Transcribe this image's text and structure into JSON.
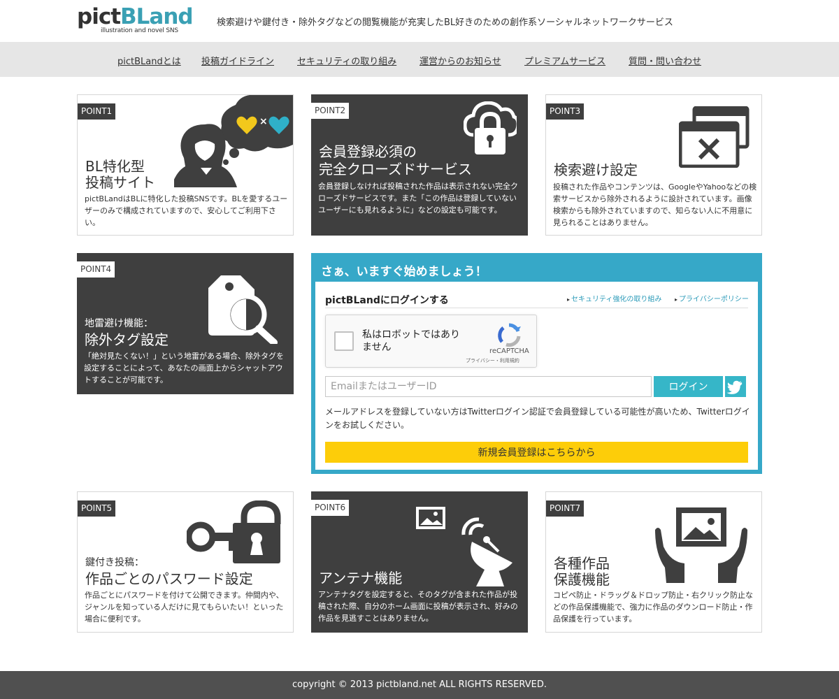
{
  "header": {
    "logo_main_a": "pict",
    "logo_main_b": "BLand",
    "logo_sub": "illustration and novel SNS",
    "tagline": "検索避けや鍵付き・除外タグなどの閲覧機能が充実したBL好きのための創作系ソーシャルネットワークサービス"
  },
  "nav": {
    "items": [
      {
        "label": "pictBLandとは"
      },
      {
        "label": "投稿ガイドライン"
      },
      {
        "label": "セキュリティの取り組み"
      },
      {
        "label": "運営からのお知らせ"
      },
      {
        "label": "プレミアムサービス"
      },
      {
        "label": "質問・問い合わせ"
      }
    ]
  },
  "points": [
    {
      "badge": "POINT1",
      "title_lines": [
        "BL特化型",
        "投稿サイト"
      ],
      "desc": "pictBLandはBLに特化した投稿SNSです。BLを愛するユーザーのみで構成されていますので、安心してご利用下さい。",
      "icon": "woman-thinking-hearts-icon"
    },
    {
      "badge": "POINT2",
      "title_lines": [
        "会員登録必須の",
        "完全クローズドサービス"
      ],
      "desc": "会員登録しなければ投稿された作品は表示されない完全クローズドサービスです。また「この作品は登録していないユーザーにも見れるように」などの設定も可能です。",
      "icon": "cloud-lock-icon"
    },
    {
      "badge": "POINT3",
      "title_lines": [
        "検索避け設定"
      ],
      "desc": "投稿された作品やコンテンツは、GoogleやYahooなどの検索サービスから除外されるように設計されています。画像検索からも除外されていますので、知らない人に不用意に見られることはありません。",
      "icon": "windows-close-icon"
    },
    {
      "badge": "POINT4",
      "subtitle": "地雷避け機能：",
      "title_lines": [
        "除外タグ設定"
      ],
      "desc": "「絶対見たくない！」という地雷がある場合、除外タグを設定することによって、あなたの画面上からシャットアウトすることが可能です。",
      "icon": "tag-search-icon"
    },
    {
      "badge": "POINT5",
      "subtitle": "鍵付き投稿：",
      "title_lines": [
        "作品ごとのパスワード設定"
      ],
      "desc": "作品ごとにパスワードを付けて公開できます。仲間内や、ジャンルを知っている人だけに見てもらいたい！といった場合に便利です。",
      "icon": "key-lock-icon"
    },
    {
      "badge": "POINT6",
      "title_lines": [
        "アンテナ機能"
      ],
      "desc": "アンテナタグを設定すると、そのタグが含まれた作品が投稿された際、自分のホーム画面に投稿が表示され、好みの作品を見逃すことはありません。",
      "icon": "satellite-dish-icon"
    },
    {
      "badge": "POINT7",
      "title_lines": [
        "各種作品",
        "保護機能"
      ],
      "desc": "コピペ防止・ドラッグ＆ドロップ防止・右クリック防止などの作品保護機能で、強力に作品のダウンロード防止・作品保護を行っています。",
      "icon": "hands-picture-icon"
    }
  ],
  "login": {
    "heading": "さぁ、いますぐ始めましょう！",
    "title": "pictBLandにログインする",
    "link_security": "セキュリティ強化の取り組み",
    "link_privacy": "プライバシーポリシー",
    "captcha_label": "私はロボットではありません",
    "captcha_brand": "reCAPTCHA",
    "captcha_terms": "プライバシー・利用規約",
    "email_placeholder": "EmailまたはユーザーID",
    "login_button": "ログイン",
    "note": "メールアドレスを登録していない方はTwitterログイン認証で会員登録している可能性が高いため、Twitterログインをお試しください。",
    "register_button": "新規会員登録はこちらから"
  },
  "footer": {
    "copyright": "copyright © 2013 pictbland.net ALL RIGHTS RESERVED."
  },
  "colors": {
    "accent": "#36a8c8",
    "dark_card": "#3f3f3f",
    "register_yellow": "#fdcd09",
    "nav_bg": "#e6e6e6",
    "footer_bg": "#505050"
  }
}
